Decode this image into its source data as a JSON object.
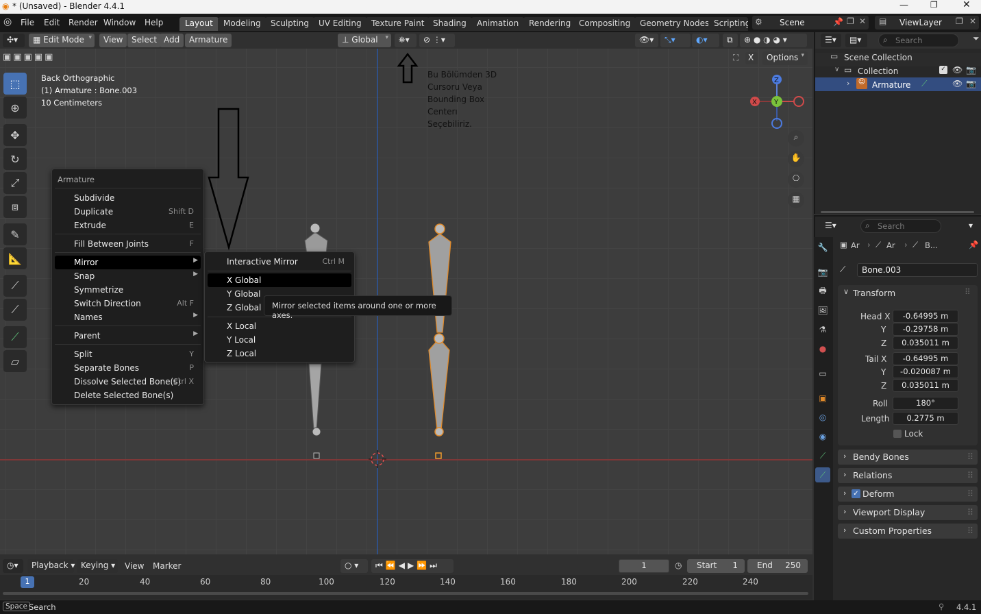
{
  "window": {
    "title": "* (Unsaved) - Blender 4.4.1"
  },
  "menus": [
    "File",
    "Edit",
    "Render",
    "Window",
    "Help"
  ],
  "workspaces": [
    "Layout",
    "Modeling",
    "Sculpting",
    "UV Editing",
    "Texture Paint",
    "Shading",
    "Animation",
    "Rendering",
    "Compositing",
    "Geometry Nodes",
    "Scripting"
  ],
  "scene": {
    "name": "Scene",
    "view_layer": "ViewLayer"
  },
  "header": {
    "mode": "Edit Mode",
    "view": "View",
    "select": "Select",
    "add": "Add",
    "armature": "Armature",
    "orientation": "Global",
    "options": "Options",
    "x_label": "X"
  },
  "overlay_text": [
    "Back Orthographic",
    "(1) Armature : Bone.003",
    "10 Centimeters"
  ],
  "annotation": [
    "Bu Bölümden 3D",
    "Cursoru Veya",
    "Bounding Box",
    "Centerı",
    "Seçebiliriz."
  ],
  "armature_menu": {
    "title": "Armature",
    "items": [
      {
        "label": "Subdivide",
        "shortcut": ""
      },
      {
        "label": "Duplicate",
        "shortcut": "Shift D"
      },
      {
        "label": "Extrude",
        "shortcut": "E"
      },
      {
        "label": "Fill Between Joints",
        "shortcut": "F"
      },
      {
        "label": "Mirror",
        "shortcut": ""
      },
      {
        "label": "Snap",
        "shortcut": ""
      },
      {
        "label": "Symmetrize",
        "shortcut": ""
      },
      {
        "label": "Switch Direction",
        "shortcut": "Alt F"
      },
      {
        "label": "Names",
        "shortcut": ""
      },
      {
        "label": "Parent",
        "shortcut": ""
      },
      {
        "label": "Split",
        "shortcut": "Y"
      },
      {
        "label": "Separate Bones",
        "shortcut": "P"
      },
      {
        "label": "Dissolve Selected Bone(s)",
        "shortcut": "Ctrl X"
      },
      {
        "label": "Delete Selected Bone(s)",
        "shortcut": ""
      }
    ]
  },
  "mirror_menu": {
    "items": [
      {
        "label": "Interactive Mirror",
        "shortcut": "Ctrl M"
      },
      {
        "label": "X Global"
      },
      {
        "label": "Y Global"
      },
      {
        "label": "Z Global"
      },
      {
        "label": "X Local"
      },
      {
        "label": "Y Local"
      },
      {
        "label": "Z Local"
      }
    ]
  },
  "tooltip": "Mirror selected items around one or more axes.",
  "gizmo": {
    "x": "X",
    "y": "Y",
    "z": "Z"
  },
  "outliner": {
    "search_placeholder": "Search",
    "scene_collection": "Scene Collection",
    "collection": "Collection",
    "armature": "Armature"
  },
  "properties": {
    "search_placeholder": "Search",
    "breadcrumb": [
      "Ar",
      "Ar",
      "B..."
    ],
    "bone_name": "Bone.003",
    "transform_title": "Transform",
    "head_x_label": "Head X",
    "head_x": "-0.64995 m",
    "head_y_label": "Y",
    "head_y": "-0.29758 m",
    "head_z_label": "Z",
    "head_z": "0.035011 m",
    "tail_x_label": "Tail X",
    "tail_x": "-0.64995 m",
    "tail_y_label": "Y",
    "tail_y": "-0.020087 m",
    "tail_z_label": "Z",
    "tail_z": "0.035011 m",
    "roll_label": "Roll",
    "roll": "180°",
    "length_label": "Length",
    "length": "0.2775 m",
    "lock": "Lock",
    "sections": [
      "Bendy Bones",
      "Relations",
      "Deform",
      "Viewport Display",
      "Custom Properties"
    ]
  },
  "timeline": {
    "playback": "Playback",
    "keying": "Keying",
    "view": "View",
    "marker": "Marker",
    "frame": "1",
    "start_label": "Start",
    "start": "1",
    "end_label": "End",
    "end": "250",
    "ticks": [
      "1",
      "20",
      "40",
      "60",
      "80",
      "100",
      "120",
      "140",
      "160",
      "180",
      "200",
      "220",
      "240"
    ]
  },
  "status": {
    "space": "Space",
    "search": "Search",
    "version": "4.4.1"
  }
}
